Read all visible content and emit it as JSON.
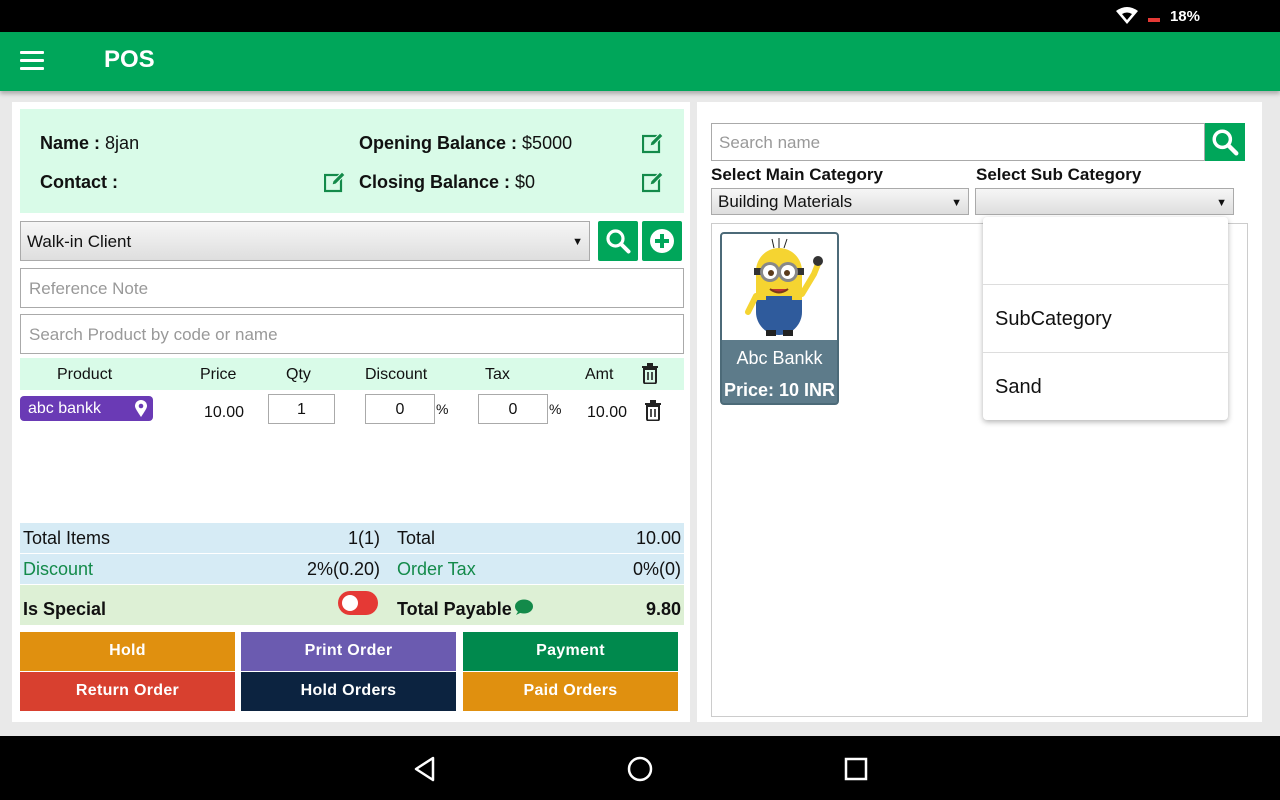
{
  "status_bar": {
    "battery": "18%",
    "wifi_icon": "wifi-icon",
    "battery_icon": "battery-low-icon"
  },
  "app_bar": {
    "title": "POS",
    "menu_icon": "hamburger-menu-icon"
  },
  "colors": {
    "primary": "#00a65a",
    "info_bg": "#d9fbe8",
    "summary_bg": "#d6ebf5",
    "chip": "#6a3ab5",
    "hold": "#e0900f",
    "print": "#6b5bb0",
    "payment": "#00894d",
    "return": "#d8402f",
    "hold_orders": "#0c2340",
    "paid": "#e0900f"
  },
  "customer_info": {
    "name_label": "Name :",
    "name_value": "8jan",
    "contact_label": "Contact :",
    "contact_value": "",
    "opening_label": "Opening Balance :",
    "opening_value": "$5000",
    "closing_label": "Closing Balance :",
    "closing_value": "$0"
  },
  "client_select": {
    "selected": "Walk-in Client"
  },
  "reference_note": {
    "placeholder": "Reference Note",
    "value": ""
  },
  "product_search": {
    "placeholder": "Search Product by code or name",
    "value": ""
  },
  "table": {
    "headers": {
      "product": "Product",
      "price": "Price",
      "qty": "Qty",
      "discount": "Discount",
      "tax": "Tax",
      "amt": "Amt"
    },
    "rows": [
      {
        "product": "abc bankk",
        "price": "10.00",
        "qty": "1",
        "discount": "0",
        "discount_unit": "%",
        "tax": "0",
        "tax_unit": "%",
        "amt": "10.00"
      }
    ]
  },
  "summary": {
    "total_items_label": "Total Items",
    "total_items_value": "1(1)",
    "total_label": "Total",
    "total_value": "10.00",
    "discount_label": "Discount",
    "discount_value": "2%(0.20)",
    "order_tax_label": "Order Tax",
    "order_tax_value": "0%(0)",
    "is_special_label": "Is Special",
    "is_special_on": false,
    "payable_label": "Total Payable",
    "payable_value": "9.80"
  },
  "actions": {
    "hold": "Hold",
    "print_order": "Print Order",
    "payment": "Payment",
    "return_order": "Return Order",
    "hold_orders": "Hold Orders",
    "paid_orders": "Paid Orders"
  },
  "catalog": {
    "search_placeholder": "Search name",
    "main_category_label": "Select Main Category",
    "main_category_value": "Building Materials",
    "sub_category_label": "Select Sub Category",
    "sub_category_value": "",
    "sub_category_options": [
      "",
      "SubCategory",
      "Sand"
    ],
    "products": [
      {
        "name": "Abc Bankk",
        "price": "Price: 10 INR",
        "image_icon": "minion-image"
      }
    ]
  },
  "nav": {
    "back_icon": "back-triangle-icon",
    "home_icon": "home-circle-icon",
    "recents_icon": "recents-square-icon"
  }
}
